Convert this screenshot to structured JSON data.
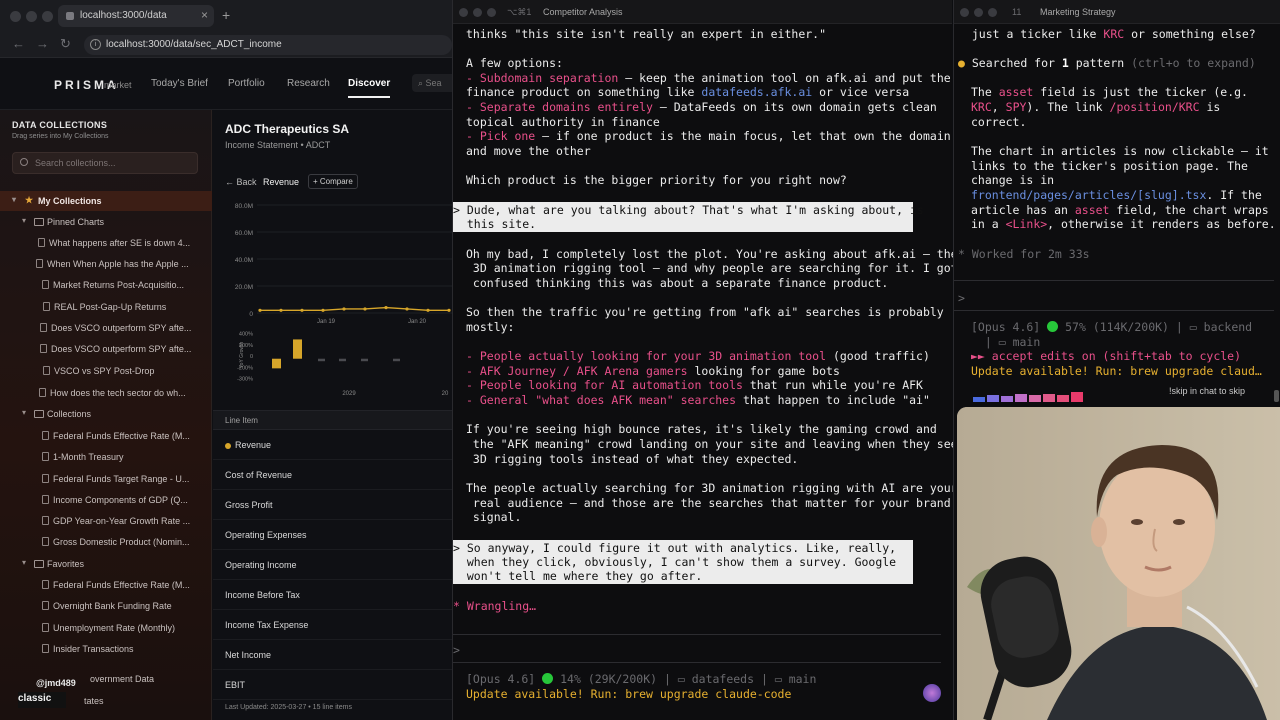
{
  "browser": {
    "tab_title": "localhost:3000/data",
    "url": "localhost:3000/data/sec_ADCT_income",
    "logo": "PRISMA",
    "logo_sub": "market",
    "nav": [
      "Today's Brief",
      "Portfolio",
      "Research",
      "Discover"
    ],
    "nav_active": "Discover",
    "nav_search_placeholder": "Sea"
  },
  "sidebar": {
    "title": "DATA COLLECTIONS",
    "subtitle": "Drag series into My Collections",
    "search_placeholder": "Search collections...",
    "my_collections": "My Collections",
    "pinned_charts": "Pinned Charts",
    "pinned_items": [
      "What happens after SE is down 4...",
      "When When Apple has the Apple ...",
      "Market Returns Post-Acquisitio...",
      "REAL Post-Gap-Up Returns",
      "Does VSCO outperform SPY afte...",
      "Does VSCO outperform SPY afte...",
      "VSCO vs SPY Post-Drop",
      "How does the tech sector do wh..."
    ],
    "collections": "Collections",
    "collection_items": [
      "Federal Funds Effective Rate (M...",
      "1-Month Treasury",
      "Federal Funds Target Range - U...",
      "Income Components of GDP (Q...",
      "GDP Year-on-Year Growth Rate ...",
      "Gross Domestic Product (Nomin..."
    ],
    "favorites": "Favorites",
    "favorite_items": [
      "Federal Funds Effective Rate (M...",
      "Overnight Bank Funding Rate",
      "Unemployment Rate (Monthly)",
      "Insider Transactions"
    ],
    "bottom_a": "overnment Data",
    "bottom_b": "tates",
    "user": "@jmd489",
    "badge": "classic"
  },
  "main": {
    "company": "ADC Therapeutics SA",
    "subtitle": "Income Statement • ADCT",
    "back": "← Back",
    "active_tab": "Revenue",
    "compare": "+ Compare",
    "line_item_header": "Line Item",
    "line_items": [
      "Revenue",
      "Cost of Revenue",
      "Gross Profit",
      "Operating Expenses",
      "Operating Income",
      "Income Before Tax",
      "Income Tax Expense",
      "Net Income",
      "EBIT"
    ],
    "last_updated": "Last Updated: 2025-03-27 • 15 line items"
  },
  "chart_data": [
    {
      "type": "line",
      "title": "",
      "y_ticks": [
        "80.0M",
        "60.0M",
        "40.0M",
        "20.0M",
        "0"
      ],
      "x_ticks": [
        "Jan 19",
        "Jan 20"
      ],
      "ylim": [
        0,
        80
      ],
      "values": [
        2,
        2,
        2,
        2,
        3,
        3,
        4,
        3,
        2,
        2
      ]
    },
    {
      "type": "bar",
      "ylabel": "YoY Growth",
      "y_ticks": [
        "400%",
        "200%",
        "0",
        "-200%",
        "-300%"
      ],
      "x_ticks": [
        "2029",
        "20"
      ],
      "ylim": [
        -300,
        400
      ],
      "values": [
        -150,
        300,
        -40,
        -40,
        -40,
        -40
      ]
    }
  ],
  "term1": {
    "title": "Competitor Analysis",
    "shortcut": "⌥⌘1",
    "lines": [
      "thinks \"this site isn't really an expert in either.\"",
      "",
      "A few options:",
      "- Subdomain separation — keep the animation tool on afk.ai and put the",
      "finance product on something like datafeeds.afk.ai or vice versa",
      "- Separate domains entirely — DataFeeds on its own domain gets clean",
      "topical authority in finance",
      "- Pick one — if one product is the main focus, let that own the domain",
      "and move the other",
      "",
      "Which product is the bigger priority for you right now?"
    ],
    "user_msg_1": [
      "> Dude, what are you talking about? That's what I'm asking about, is",
      "  this site."
    ],
    "reply": [
      "Oh my bad, I completely lost the plot. You're asking about afk.ai — the",
      " 3D animation rigging tool — and why people are searching for it. I got",
      " confused thinking this was about a separate finance product.",
      "",
      "So then the traffic you're getting from \"afk ai\" searches is probably",
      "mostly:",
      "",
      "- People actually looking for your 3D animation tool (good traffic)",
      "- AFK Journey / AFK Arena gamers looking for game bots",
      "- People looking for AI automation tools that run while you're AFK",
      "- General \"what does AFK mean\" searches that happen to include \"ai\"",
      "",
      "If you're seeing high bounce rates, it's likely the gaming crowd and",
      " the \"AFK meaning\" crowd landing on your site and leaving when they see",
      " 3D rigging tools instead of what they expected.",
      "",
      "The people actually searching for 3D animation rigging with AI are your",
      " real audience — and those are the searches that matter for your brand",
      " signal."
    ],
    "user_msg_2": [
      "> So anyway, I could figure it out with analytics. Like, really,",
      "  when they click, obviously, I can't show them a survey. Google",
      "  won't tell me where they go after."
    ],
    "status": "* Wrangling…",
    "prompt": ">",
    "statusbar": "[Opus 4.6] 🟢 14% (29K/200K) | 📁 datafeeds | 📁 main",
    "statusbar_parts": {
      "model": "[Opus 4.6]",
      "pct": "14% (29K/200K)",
      "dir": "datafeeds",
      "branch": "main"
    },
    "update": "Update available! Run: brew upgrade claude-code"
  },
  "term2": {
    "title": "Marketing Strategy",
    "shortcut": "11",
    "line_top": "  just a ticker like KRC or something else?",
    "searched": "Searched for 1 pattern",
    "searched_hint": "(ctrl+o to expand)",
    "body": [
      "The asset field is just the ticker (e.g.",
      "KRC, SPY). The link /position/KRC is",
      "correct.",
      "",
      "The chart in articles is now clickable — it",
      "links to the ticker's position page. The",
      "change is in",
      "frontend/pages/articles/[slug].tsx. If the",
      "article has an asset field, the chart wraps",
      "in a <Link>, otherwise it renders as before."
    ],
    "worked": "* Worked for 2m 33s",
    "prompt": ">",
    "statusbar_parts": {
      "model": "[Opus 4.6]",
      "pct": "57% (114K/200K)",
      "dir": "backend",
      "branch": "main"
    },
    "accept": "►► accept edits on (shift+tab to cycle)",
    "update": "Update available! Run: brew upgrade claud…",
    "skip": "!skip in chat to skip"
  },
  "colors": {
    "accent_pink": "#e8508a",
    "link_blue": "#6a8fe0",
    "gold": "#d7a62a",
    "status_green": "#27c73a"
  }
}
